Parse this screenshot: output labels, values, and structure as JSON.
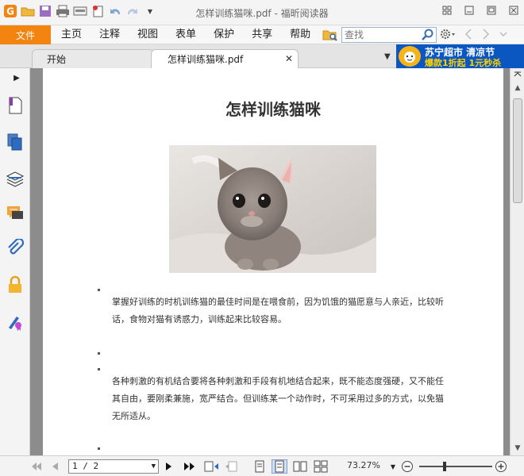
{
  "window": {
    "title": "怎样训练猫咪.pdf - 福昕阅读器"
  },
  "menubar": {
    "file_label": "文件",
    "items": [
      "主页",
      "注释",
      "视图",
      "表单",
      "保护",
      "共享",
      "帮助"
    ],
    "search_placeholder": "查找"
  },
  "tabs": [
    {
      "label": "开始"
    },
    {
      "label": "怎样训练猫咪.pdf"
    }
  ],
  "ad": {
    "line1": "苏宁超市 清凉节",
    "line2": "爆款1折起 1元秒杀"
  },
  "document": {
    "title": "怎样训练猫咪",
    "paragraphs": [
      "掌握好训练的时机训练猫的最佳时间是在喂食前，因为饥饿的猫愿意与人亲近，比较听话，食物对猫有诱惑力，训练起来比较容易。",
      "各种刺激的有机结合要将各种刺激和手段有机地结合起来，既不能态度强硬，又不能任其自由，要刚柔兼施，宽严结合。但训练某一个动作时，不可采用过多的方式，以免猫无所适从。"
    ]
  },
  "statusbar": {
    "page_value": "1 / 2",
    "zoom": "73.27%"
  },
  "colors": {
    "accent": "#f2840f",
    "ad_bg": "#0a57c2",
    "page_bg": "#8c8c8c"
  }
}
